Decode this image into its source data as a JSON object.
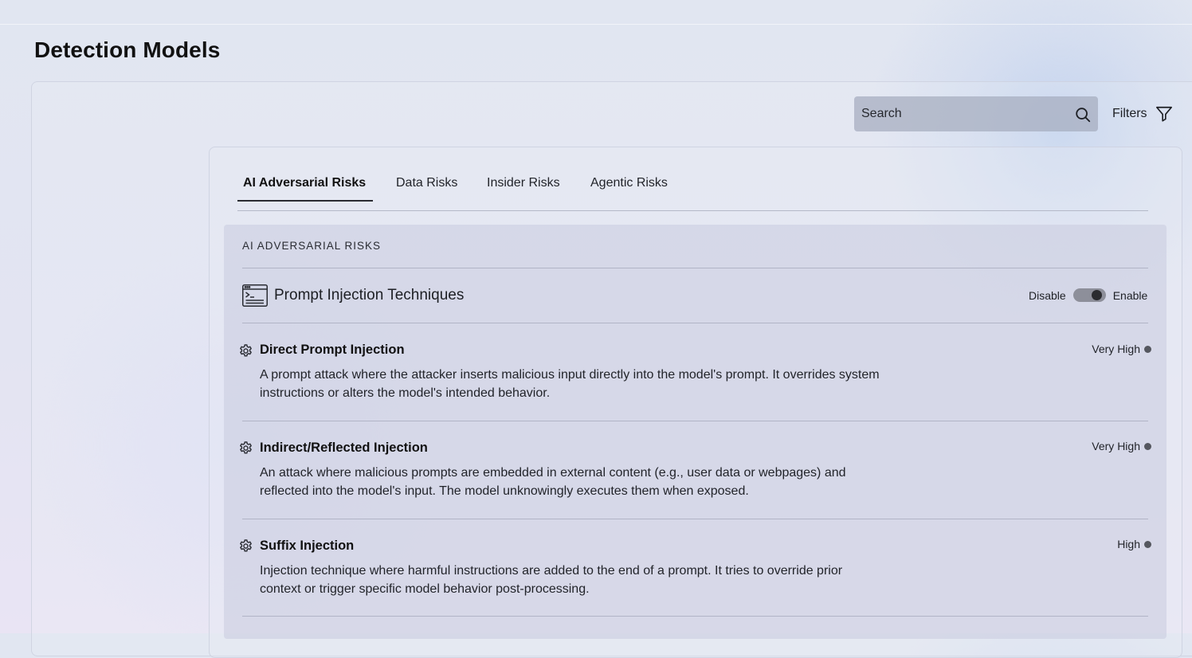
{
  "page": {
    "title": "Detection Models"
  },
  "toolbar": {
    "search_placeholder": "Search",
    "search_icon": "search-icon",
    "filters_label": "Filters",
    "filters_icon": "filter-icon"
  },
  "tabs": [
    {
      "label": "AI Adversarial Risks",
      "active": true
    },
    {
      "label": "Data Risks",
      "active": false
    },
    {
      "label": "Insider Risks",
      "active": false
    },
    {
      "label": "Agentic Risks",
      "active": false
    }
  ],
  "section": {
    "label": "AI ADVERSARIAL RISKS",
    "group": {
      "icon": "terminal-icon",
      "title": "Prompt Injection Techniques",
      "toggle": {
        "off_label": "Disable",
        "on_label": "Enable",
        "enabled": true
      }
    },
    "items": [
      {
        "icon": "gear-icon",
        "title": "Direct Prompt Injection",
        "desc_line1": "A prompt attack where the attacker inserts malicious input directly into the model's prompt. It overrides system",
        "desc_line2": "instructions or alters the model's intended behavior.",
        "risk": "Very High"
      },
      {
        "icon": "gear-icon",
        "title": "Indirect/Reflected Injection",
        "desc_line1": "An attack where malicious prompts are embedded in external content (e.g., user data or webpages) and",
        "desc_line2": "reflected into the model's input. The model unknowingly executes them when exposed.",
        "risk": "Very High"
      },
      {
        "icon": "gear-icon",
        "title": "Suffix Injection",
        "desc_line1": "Injection technique where harmful instructions are added to the end of a prompt. It tries to override prior",
        "desc_line2": "context or trigger specific model behavior post-processing.",
        "risk": "High"
      }
    ]
  },
  "colors": {
    "search_bg": "#a5acbe",
    "section_bg": "#c8cade",
    "toggle_track": "#8d8f9a",
    "risk_dot": "#55575f"
  }
}
